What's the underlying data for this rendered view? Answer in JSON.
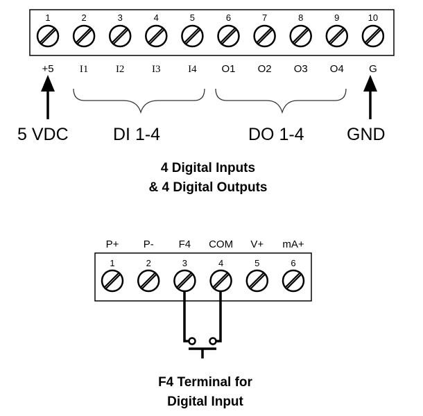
{
  "top_block": {
    "terminals": [
      {
        "number": "1",
        "label": "+5",
        "label_font": "sans"
      },
      {
        "number": "2",
        "label": "I1",
        "label_font": "serif"
      },
      {
        "number": "3",
        "label": "I2",
        "label_font": "serif"
      },
      {
        "number": "4",
        "label": "I3",
        "label_font": "serif"
      },
      {
        "number": "5",
        "label": "I4",
        "label_font": "serif"
      },
      {
        "number": "6",
        "label": "O1",
        "label_font": "sans"
      },
      {
        "number": "7",
        "label": "O2",
        "label_font": "sans"
      },
      {
        "number": "8",
        "label": "O3",
        "label_font": "sans"
      },
      {
        "number": "9",
        "label": "O4",
        "label_font": "sans"
      },
      {
        "number": "10",
        "label": "G",
        "label_font": "sans"
      }
    ],
    "arrow_labels": {
      "left": "5 VDC",
      "right": "GND"
    },
    "group_labels": {
      "inputs": "DI 1-4",
      "outputs": "DO 1-4"
    },
    "caption": [
      "4 Digital Inputs",
      "& 4 Digital Outputs"
    ]
  },
  "bottom_block": {
    "terminals": [
      {
        "number": "1",
        "label": "P+"
      },
      {
        "number": "2",
        "label": "P-"
      },
      {
        "number": "3",
        "label": "F4"
      },
      {
        "number": "4",
        "label": "COM"
      },
      {
        "number": "5",
        "label": "V+"
      },
      {
        "number": "6",
        "label": "mA+"
      }
    ],
    "switch_connects": [
      "F4",
      "COM"
    ],
    "caption": [
      "F4 Terminal for",
      "Digital Input"
    ]
  },
  "colors": {
    "line": "#000000",
    "background": "#ffffff"
  }
}
